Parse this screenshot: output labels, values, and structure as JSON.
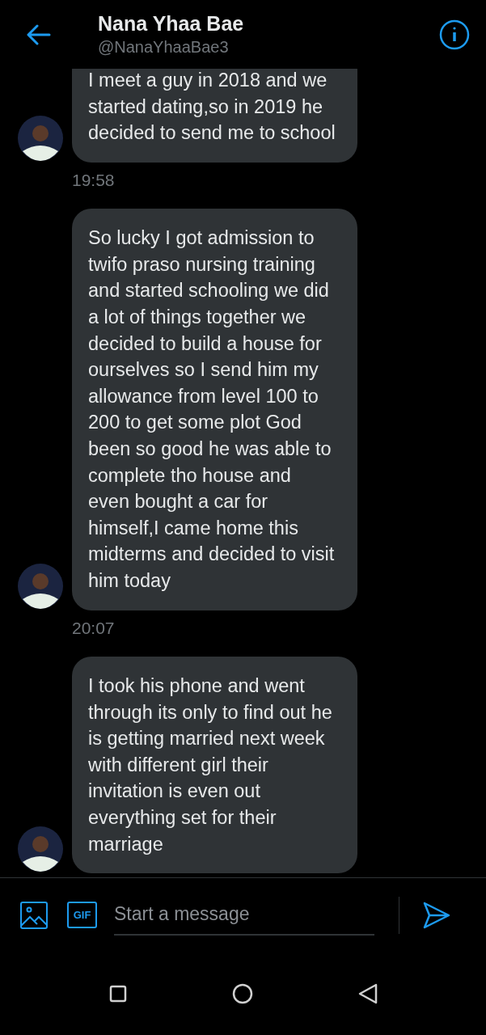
{
  "header": {
    "name": "Nana Yhaa Bae",
    "handle": "@NanaYhaaBae3"
  },
  "messages": [
    {
      "text": "I meet a guy in 2018 and we started dating,so in 2019 he decided to send me to school",
      "time": "19:58"
    },
    {
      "text": "So lucky I got admission to twifo praso nursing training and started schooling we did a lot of things together we decided to build a house for ourselves so I send him my allowance from level 100 to 200 to get some plot God been so good he was able to complete tho house and even bought a car for himself,I came home this midterms and decided to visit him today",
      "time": "20:07"
    },
    {
      "text": "I took his phone and went through its only to find out he is getting married next week with different girl their invitation is even out everything set for their marriage"
    }
  ],
  "composer": {
    "gif_label": "GIF",
    "placeholder": "Start a message"
  }
}
